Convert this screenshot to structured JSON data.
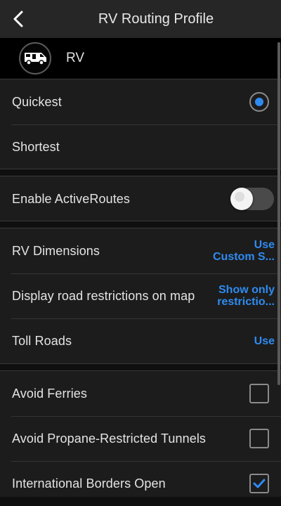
{
  "header": {
    "title": "RV Routing Profile",
    "back_icon": "chevron-left-icon"
  },
  "profile": {
    "vehicle_name": "RV",
    "vehicle_icon": "rv-icon"
  },
  "route_type": {
    "options": [
      {
        "label": "Quickest",
        "selected": true
      },
      {
        "label": "Shortest",
        "selected": false
      }
    ]
  },
  "active_routes": {
    "label": "Enable ActiveRoutes",
    "enabled": false
  },
  "settings": {
    "rv_dimensions": {
      "label": "RV Dimensions",
      "value_line1": "Use",
      "value_line2": "Custom S..."
    },
    "road_restrictions": {
      "label": "Display road restrictions on map",
      "value_line1": "Show only",
      "value_line2": "restrictio..."
    },
    "toll_roads": {
      "label": "Toll Roads",
      "value": "Use"
    }
  },
  "avoid": {
    "items": [
      {
        "label": "Avoid Ferries",
        "checked": false
      },
      {
        "label": "Avoid Propane-Restricted Tunnels",
        "checked": false
      },
      {
        "label": "International Borders Open",
        "checked": true
      }
    ]
  },
  "colors": {
    "accent": "#2f8bf0",
    "background": "#0f0f0f",
    "panel": "#1c1c1c",
    "header": "#262626"
  }
}
